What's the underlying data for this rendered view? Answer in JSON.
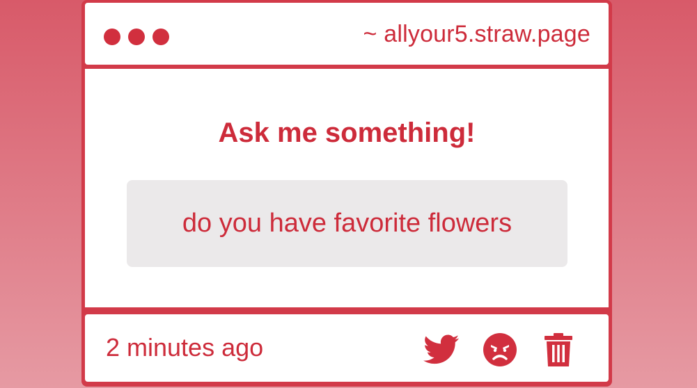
{
  "window": {
    "url": "~ allyour5.straw.page"
  },
  "main": {
    "title": "Ask me something!",
    "question": "do you have favorite flowers"
  },
  "footer": {
    "timestamp": "2 minutes ago",
    "actions": [
      {
        "icon": "twitter-icon"
      },
      {
        "icon": "angry-face-icon"
      },
      {
        "icon": "trash-icon"
      }
    ]
  },
  "colors": {
    "accent": "#cd2b3a",
    "background_top": "#d85a69",
    "background_bottom": "#e69aa3",
    "question_box": "#ebe9ea"
  }
}
